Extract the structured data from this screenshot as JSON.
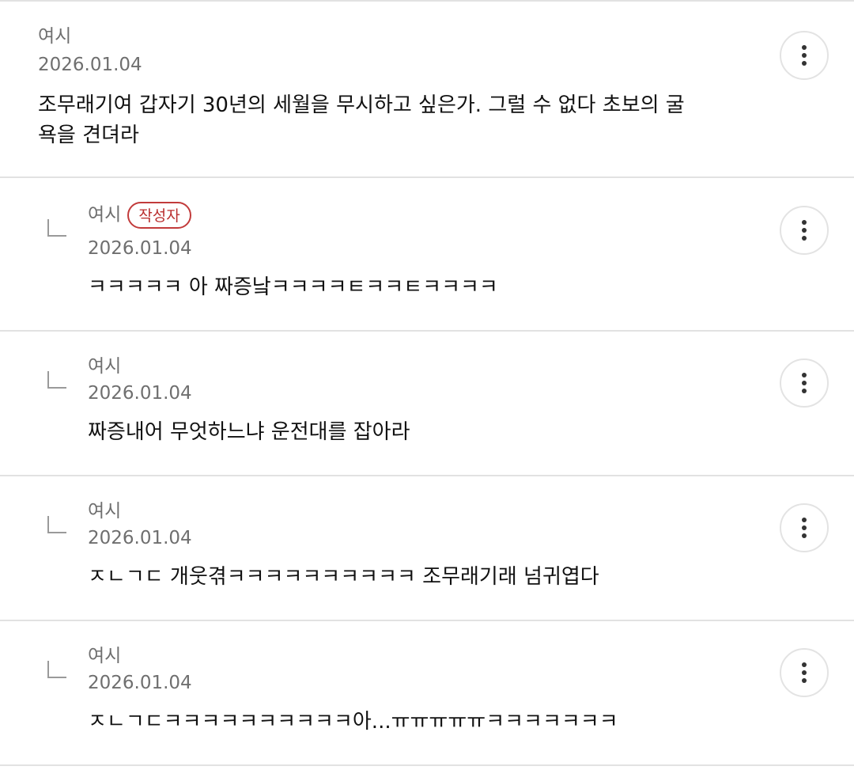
{
  "comments": [
    {
      "author": "여시",
      "date": "2026.01.04",
      "text": "조무래기여 갑자기 30년의 세월을 무시하고 싶은가. 그럴 수 없다 초보의 굴\n욕을 견뎌라",
      "is_reply": false
    },
    {
      "author": "여시",
      "badge": "작성자",
      "date": "2026.01.04",
      "text": "ㅋㅋㅋㅋㅋ 아 짜증낰ㅋㅋㅋㅋㅌㅋㅋㅌㅋㅋㅋㅋ",
      "is_reply": true
    },
    {
      "author": "여시",
      "date": "2026.01.04",
      "text": "짜증내어 무엇하느냐 운전대를 잡아라",
      "is_reply": true
    },
    {
      "author": "여시",
      "date": "2026.01.04",
      "text": "ㅈㄴㄱㄷ 개웃겪ㅋㅋㅋㅋㅋㅋㅋㅋㅋㅋ 조무래기래 넘귀엽다",
      "is_reply": true
    },
    {
      "author": "여시",
      "date": "2026.01.04",
      "text": "ㅈㄴㄱㄷㅋㅋㅋㅋㅋㅋㅋㅋㅋㅋ아...ㅠㅠㅠㅠㅠㅋㅋㅋㅋㅋㅋㅋ",
      "is_reply": true
    }
  ],
  "icons": {
    "more": "more-vertical-icon",
    "reply": "reply-arrow-icon"
  },
  "colors": {
    "author_badge": "#b92d2d",
    "meta_text": "#6f6f6f",
    "divider": "#e2e2e2"
  }
}
